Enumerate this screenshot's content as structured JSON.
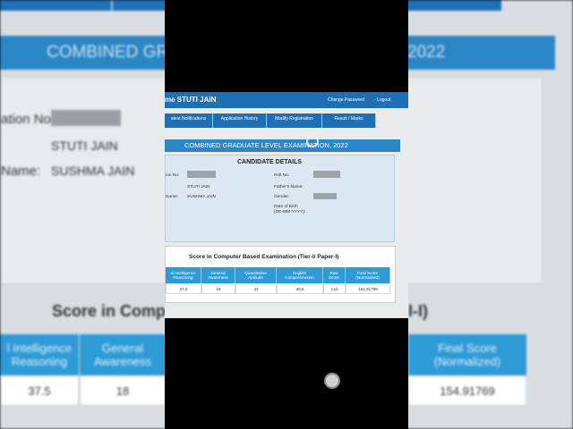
{
  "background": {
    "banner_left": "COMBINED GRA",
    "banner_right": "2022",
    "label_top": "ation No:",
    "value_name": "STUTI JAIN",
    "label_mother": "Name:",
    "value_mother": "SUSHMA JAIN",
    "score_title_left": "Score in Comput",
    "score_title_right": "I-I)",
    "headers": [
      "l Intelligence\nReasoning",
      "General\nAwareness",
      "",
      "Final Score\n(Normalized)"
    ],
    "values": [
      "37.5",
      "18",
      "",
      "154.91769"
    ]
  },
  "header": {
    "welcome": "me STUTI JAIN",
    "change_password": "Change Password",
    "logout": "Logout"
  },
  "tabs": [
    {
      "label": "atest Notifications"
    },
    {
      "label": "Application History"
    },
    {
      "label": "Modify Registration"
    },
    {
      "label": "Result / Marks"
    }
  ],
  "exam": {
    "title": "COMBINED GRADUATE LEVEL EXAMINATION, 2022"
  },
  "candidate": {
    "section_title": "CANDIDATE DETAILS",
    "registration_label": "ion No:",
    "name_value": "STUTI JAIN",
    "mother_label": "Name:",
    "mother_value": "SUSHMA JAIN",
    "roll_label": "Roll No:",
    "father_label": "Father's Name:",
    "gender_label": "Gender:",
    "dob_label": "Date of Birth\n(DD-MM-YYYY):"
  },
  "score": {
    "title": "Score in Computer Based Examination (Tier-I/ Paper-I)",
    "columns": [
      {
        "header": "al Intelligence\nReasoning",
        "value": "37.5"
      },
      {
        "header": "General\nAwareness",
        "value": "18"
      },
      {
        "header": "Quantitative\nAptitude",
        "value": "43"
      },
      {
        "header": "English\nComprehension",
        "value": "45.5"
      },
      {
        "header": "Raw\nScore",
        "value": "144"
      },
      {
        "header": "Final Score\n(Normalized)",
        "value": "154.91769"
      }
    ]
  }
}
